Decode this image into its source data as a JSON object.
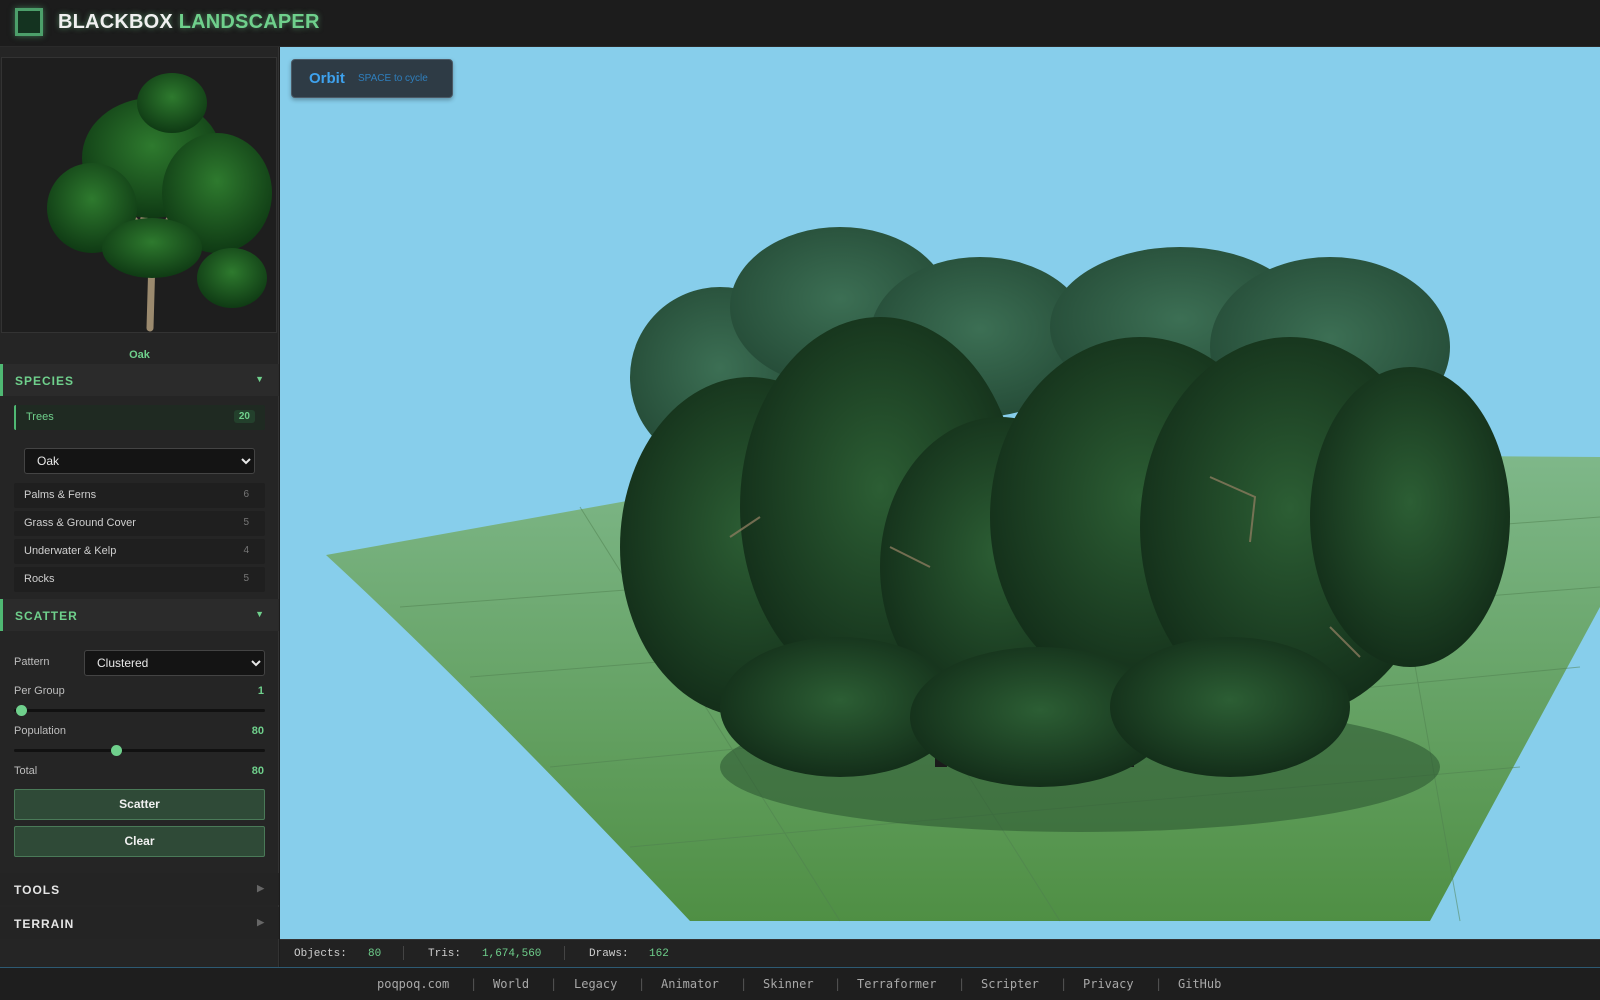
{
  "app": {
    "title_part1": "BLACKBOX",
    "title_part2": "LANDSCAPER"
  },
  "preview": {
    "name": "Oak"
  },
  "species": {
    "title": "SPECIES",
    "categories": [
      {
        "label": "Trees",
        "count": "20"
      },
      {
        "label": "Palms & Ferns",
        "count": "6"
      },
      {
        "label": "Grass & Ground Cover",
        "count": "5"
      },
      {
        "label": "Underwater & Kelp",
        "count": "4"
      },
      {
        "label": "Rocks",
        "count": "5"
      }
    ],
    "selected_tree": "Oak"
  },
  "scatter": {
    "title": "SCATTER",
    "pattern_label": "Pattern",
    "pattern_value": "Clustered",
    "per_group_label": "Per Group",
    "per_group_value": "1",
    "per_group_fraction": 0.0,
    "population_label": "Population",
    "population_value": "80",
    "population_fraction": 0.4,
    "total_label": "Total",
    "total_value": "80",
    "scatter_button": "Scatter",
    "clear_button": "Clear"
  },
  "tools": {
    "title": "TOOLS"
  },
  "terrain": {
    "title": "TERRAIN"
  },
  "viewport": {
    "mode": "Orbit",
    "hint": "SPACE to cycle"
  },
  "stats": {
    "objects_label": "Objects:",
    "objects_value": "80",
    "tris_label": "Tris:",
    "tris_value": "1,674,560",
    "draws_label": "Draws:",
    "draws_value": "162"
  },
  "footer": {
    "links": [
      "poqpoq.com",
      "World",
      "Legacy",
      "Animator",
      "Skinner",
      "Terraformer",
      "Scripter",
      "Privacy",
      "GitHub"
    ]
  },
  "colors": {
    "accent": "#6fd08c",
    "sky": "#87ceeb",
    "ground": "#5a9a5a",
    "foliage": "#1f4a2a"
  },
  "icons": {
    "logo": "square-logo-icon",
    "expand": "chevron-down-icon",
    "collapsed": "chevron-right-icon"
  }
}
